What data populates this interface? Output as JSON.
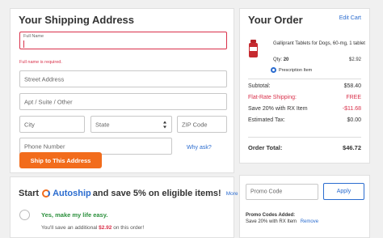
{
  "shipping": {
    "title": "Your Shipping Address",
    "full_name_label": "Full Name",
    "full_name_error": "Full name is required.",
    "street_placeholder": "Street Address",
    "apt_placeholder": "Apt / Suite / Other",
    "city_placeholder": "City",
    "state_placeholder": "State",
    "zip_placeholder": "ZIP Code",
    "phone_placeholder": "Phone Number",
    "why_ask": "Why ask?",
    "submit_label": "Ship to This Address"
  },
  "order": {
    "title": "Your Order",
    "edit_cart": "Edit Cart",
    "item": {
      "name": "Galliprant Tablets for Dogs, 60-mg, 1 tablet",
      "qty_label": "Qty:",
      "qty": "20",
      "price": "$2.92",
      "rx_label": "Prescription Item",
      "icon": "pill-bottle-icon"
    },
    "summary": [
      {
        "label": "Subtotal:",
        "value": "$58.40",
        "highlight": false
      },
      {
        "label": "Flat-Rate Shipping:",
        "value": "FREE",
        "highlight": true
      },
      {
        "label": "Save 20% with RX Item",
        "value": "-$11.68",
        "highlight": true
      },
      {
        "label": "Estimated Tax:",
        "value": "$0.00",
        "highlight": false
      }
    ],
    "total_label": "Order Total:",
    "total_value": "$46.72"
  },
  "autoship": {
    "prefix": "Start",
    "brand": "Autoship",
    "suffix": "and save 5% on eligible items!",
    "more_info": "More info",
    "option_label": "Yes, make my life easy.",
    "save_prefix": "You'll save an additional",
    "save_amount": "$2.92",
    "save_suffix": "on this order!"
  },
  "promo": {
    "placeholder": "Promo Code",
    "apply_label": "Apply",
    "applied_title": "Promo Codes Added:",
    "applied_code": "Save 20% with RX Item",
    "remove_label": "Remove"
  },
  "colors": {
    "accent": "#f26c1c",
    "link": "#2b6ccf",
    "error": "#d9304a",
    "success": "#2a8f3b"
  }
}
